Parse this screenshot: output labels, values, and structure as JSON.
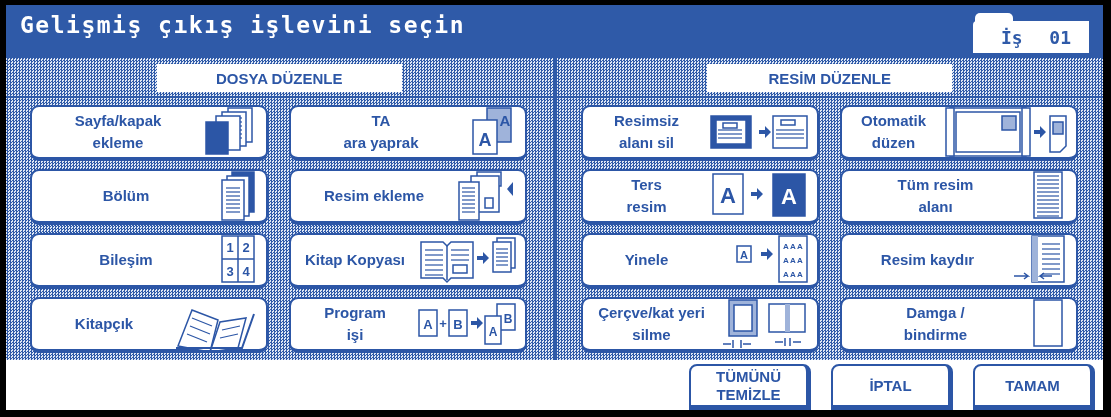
{
  "window": {
    "title": "Gelişmiş çıkış işlevini seçin"
  },
  "job": {
    "label": "İş",
    "number": "01"
  },
  "sections": [
    {
      "title": "DOSYA DÜZENLE",
      "buttons": [
        {
          "lines": [
            "Sayfa/kapak",
            "ekleme"
          ]
        },
        {
          "lines": [
            "TA",
            "ara yaprak"
          ],
          "glyphs": [
            "A",
            "A"
          ]
        },
        {
          "lines": [
            "Bölüm"
          ]
        },
        {
          "lines": [
            "Resim ekleme"
          ]
        },
        {
          "lines": [
            "Bileşim"
          ],
          "glyphs": [
            "1",
            "2",
            "3",
            "4"
          ]
        },
        {
          "lines": [
            "Kitap Kopyası"
          ]
        },
        {
          "lines": [
            "Kitapçık"
          ]
        },
        {
          "lines": [
            "Program",
            "işi"
          ],
          "glyphs": [
            "A",
            "+",
            "B",
            "A",
            "B"
          ]
        }
      ]
    },
    {
      "title": "RESİM DÜZENLE",
      "buttons": [
        {
          "lines": [
            "Resimsiz",
            "alanı sil"
          ]
        },
        {
          "lines": [
            "Otomatik",
            "düzen"
          ]
        },
        {
          "lines": [
            "Ters",
            "resim"
          ],
          "glyphs": [
            "A",
            "A"
          ]
        },
        {
          "lines": [
            "Tüm resim",
            "alanı"
          ]
        },
        {
          "lines": [
            "Yinele"
          ],
          "glyphs": [
            "A",
            "A",
            "A",
            "A",
            "A",
            "A",
            "A",
            "A",
            "A",
            "A"
          ]
        },
        {
          "lines": [
            "Resim kaydır"
          ]
        },
        {
          "lines": [
            "Çerçve/kat yeri",
            "silme"
          ]
        },
        {
          "lines": [
            "Damga /",
            "bindirme"
          ]
        }
      ]
    }
  ],
  "footer_buttons": [
    {
      "lines": [
        "TÜMÜNÜ",
        "TEMİZLE"
      ]
    },
    {
      "lines": [
        "İPTAL"
      ]
    },
    {
      "lines": [
        "TAMAM"
      ]
    }
  ]
}
